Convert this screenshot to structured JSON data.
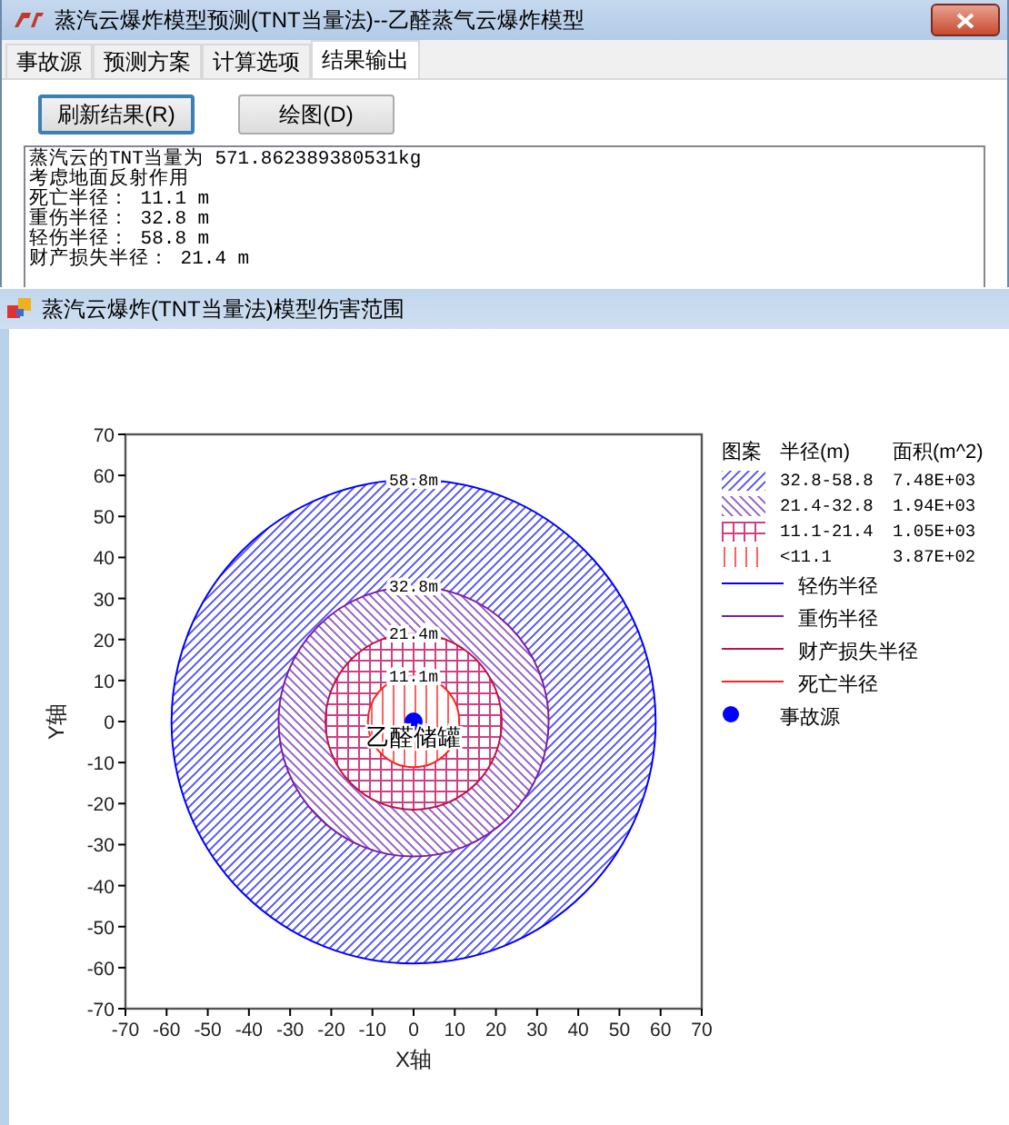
{
  "main_window": {
    "title": "蒸汽云爆炸模型预测(TNT当量法)--乙醛蒸气云爆炸模型",
    "tabs": [
      {
        "label": "事故源",
        "selected": false
      },
      {
        "label": "预测方案",
        "selected": false
      },
      {
        "label": "计算选项",
        "selected": false
      },
      {
        "label": "结果输出",
        "selected": true
      }
    ],
    "buttons": [
      {
        "label": "刷新结果(R)",
        "focused": true
      },
      {
        "label": "绘图(D)",
        "focused": false
      }
    ],
    "output_lines": [
      "蒸汽云的TNT当量为 571.862389380531kg",
      "考虑地面反射作用",
      "死亡半径： 11.1 m",
      "重伤半径： 32.8 m",
      "轻伤半径： 58.8 m",
      "财产损失半径： 21.4 m"
    ]
  },
  "chart_window": {
    "title": "蒸汽云爆炸(TNT当量法)模型伤害范围",
    "chart_data": {
      "type": "scatter",
      "xlabel": "X轴",
      "ylabel": "Y轴",
      "xlim": [
        -70,
        70
      ],
      "ylim": [
        -70,
        70
      ],
      "xticks": [
        -70,
        -60,
        -50,
        -40,
        -30,
        -20,
        -10,
        0,
        10,
        20,
        30,
        40,
        50,
        60,
        70
      ],
      "yticks": [
        -70,
        -60,
        -50,
        -40,
        -30,
        -20,
        -10,
        0,
        10,
        20,
        30,
        40,
        50,
        60,
        70
      ],
      "series": [
        {
          "name": "事故源",
          "color": "#0000ff",
          "x": [
            0
          ],
          "values": [
            0
          ]
        }
      ],
      "annotations": [
        {
          "text": "58.8m"
        },
        {
          "text": "32.8m"
        },
        {
          "text": "21.4m"
        },
        {
          "text": "11.1m"
        },
        {
          "text": "乙醛储罐"
        }
      ]
    },
    "legend": {
      "headers": [
        "图案",
        "半径(m)",
        "面积(m^2)"
      ],
      "rows": [
        {
          "kind": "pattern",
          "color": "#6666ff",
          "range": "32.8-58.8",
          "area": "7.48E+03"
        },
        {
          "kind": "pattern",
          "color": "#a070d0",
          "range": "21.4-32.8",
          "area": "1.94E+03"
        },
        {
          "kind": "pattern",
          "color": "#d04080",
          "range": "11.1-21.4",
          "area": "1.05E+03"
        },
        {
          "kind": "pattern",
          "color": "#ff6060",
          "range": "<11.1",
          "area": "3.87E+02"
        },
        {
          "kind": "line",
          "color": "#0000ff",
          "label": "轻伤半径"
        },
        {
          "kind": "line",
          "color": "#7a1fa8",
          "label": "重伤半径"
        },
        {
          "kind": "line",
          "color": "#c0104a",
          "label": "财产损失半径"
        },
        {
          "kind": "line",
          "color": "#ff2020",
          "label": "死亡半径"
        }
      ]
    }
  }
}
